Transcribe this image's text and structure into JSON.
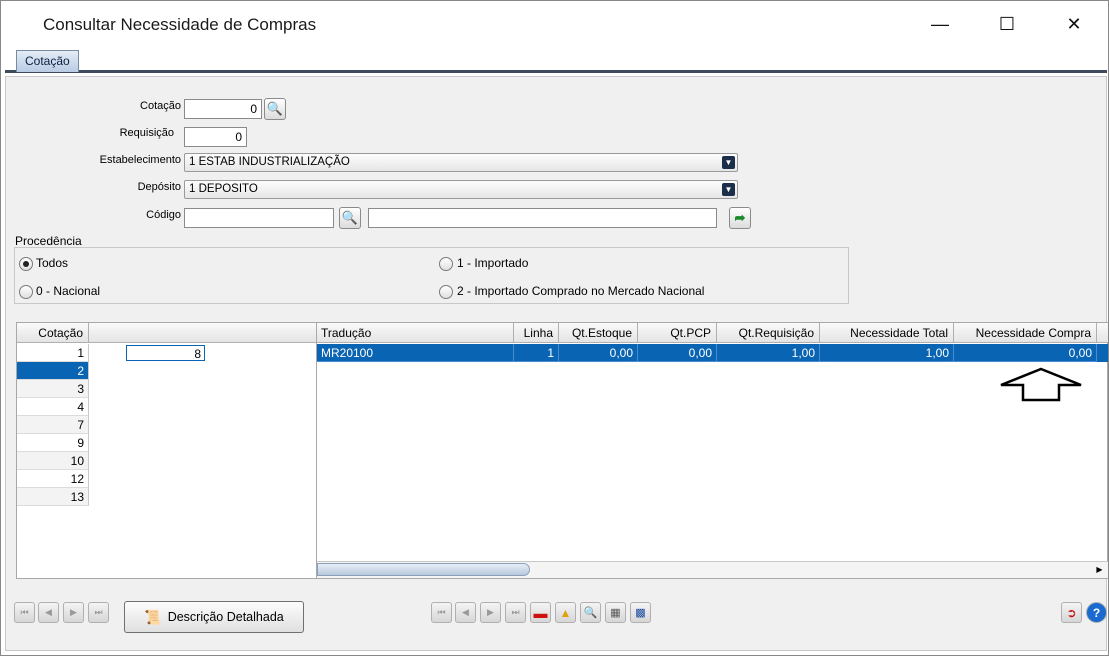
{
  "window": {
    "title": "Consultar Necessidade de Compras",
    "minimize": "—",
    "maximize": "☐",
    "close": "✕"
  },
  "tabs": [
    {
      "label": "Cotação"
    }
  ],
  "form": {
    "cotacao_label": "Cotação",
    "cotacao_value": "0",
    "requisicao_label": "Requisição",
    "requisicao_value": "0",
    "estabelecimento_label": "Estabelecimento",
    "estabelecimento_value": "1 ESTAB INDUSTRIALIZAÇÃO",
    "deposito_label": "Depósito",
    "deposito_value": "1 DEPOSITO",
    "codigo_label": "Código",
    "codigo_value": "",
    "codigo_desc": ""
  },
  "procedencia": {
    "label": "Procedência",
    "options": [
      {
        "label": "Todos",
        "checked": true
      },
      {
        "label": "1 - Importado",
        "checked": false
      },
      {
        "label": "0 - Nacional",
        "checked": false
      },
      {
        "label": "2 - Importado Comprado no Mercado Nacional",
        "checked": false
      }
    ]
  },
  "left_grid": {
    "header": "Cotação",
    "rows": [
      "1",
      "2",
      "3",
      "4",
      "7",
      "9",
      "10",
      "12",
      "13"
    ],
    "selected_index": 1,
    "side_value": "8"
  },
  "right_grid": {
    "headers": [
      "Tradução",
      "Linha",
      "Qt.Estoque",
      "Qt.PCP",
      "Qt.Requisição",
      "Necessidade Total",
      "Necessidade Compra"
    ],
    "rows": [
      [
        "MR20100",
        "1",
        "0,00",
        "0,00",
        "1,00",
        "1,00",
        "0,00"
      ]
    ]
  },
  "buttons": {
    "descricao": "Descrição Detalhada"
  },
  "colors": {
    "selection": "#0a64b4",
    "tab_border": "#3c4a5c"
  }
}
